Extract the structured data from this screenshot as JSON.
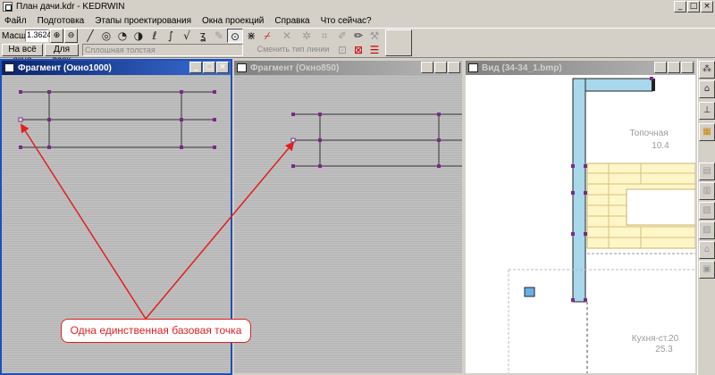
{
  "window": {
    "title": "План дачи.kdr - KEDRWIN",
    "controls": {
      "minimize": "_",
      "maximize": "□",
      "close": "×"
    }
  },
  "menu": [
    "Файл",
    "Подготовка",
    "Этапы проектирования",
    "Окна проекций",
    "Справка",
    "Что сейчас?"
  ],
  "toolbar": {
    "scale_label": "Масшт",
    "scale_value": "1.3624",
    "fit_window_label": "На всё окно",
    "for_all_label": "Для всех",
    "line_type_value": "Сплошная толстая",
    "change_line_type_label": "Сменить тип линии",
    "icons": [
      "zoom-in-icon",
      "zoom-out-icon",
      "line-icon",
      "circle-icon",
      "arc-icon",
      "curve-icon",
      "snap-icon",
      "point-icon"
    ]
  },
  "windows": [
    {
      "title": "Фрагмент (Окно1000)"
    },
    {
      "title": "Фрагмент (Окно850)"
    },
    {
      "title": "Вид (34-34_1.bmp)"
    }
  ],
  "plan": {
    "room1": "Топочная",
    "room1_area": "10.4",
    "room2": "Кухня-ст.20",
    "room2_area": "25.3"
  },
  "annotation": {
    "text": "Одна единственная базовая точка",
    "color": "#e02020"
  },
  "colors": {
    "active_title": "#0a246a",
    "wall_fill": "#a8d8ec",
    "stair_fill": "#fff6c8",
    "handle": "#7a2a8a"
  }
}
